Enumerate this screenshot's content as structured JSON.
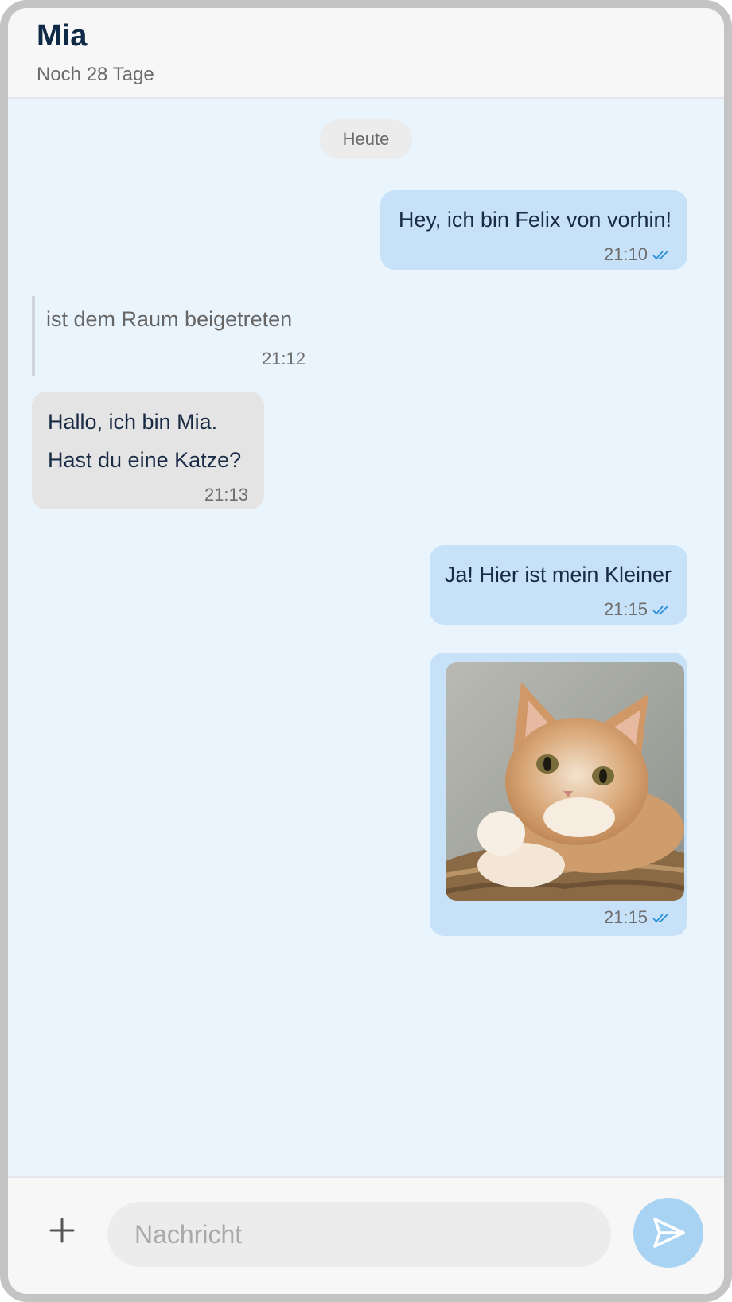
{
  "header": {
    "title": "Mia",
    "subtitle": "Noch 28 Tage"
  },
  "day_separator": "Heute",
  "messages": [
    {
      "type": "outgoing",
      "text": "Hey, ich bin Felix von vorhin!",
      "time": "21:10",
      "status": "read"
    },
    {
      "type": "system",
      "text": "ist dem Raum beigetreten",
      "time": "21:12"
    },
    {
      "type": "incoming",
      "lines": [
        "Hallo, ich bin Mia.",
        "Hast du eine Katze?"
      ],
      "time": "21:13"
    },
    {
      "type": "outgoing",
      "text": "Ja! Hier ist mein Kleiner",
      "time": "21:15",
      "status": "read"
    },
    {
      "type": "outgoing-image",
      "image": "orange-white-cat-on-wicker-basket",
      "time": "21:15",
      "status": "read"
    }
  ],
  "composer": {
    "placeholder": "Nachricht",
    "add_icon": "plus-icon",
    "send_icon": "send-icon"
  },
  "colors": {
    "background": "#eaf4fd",
    "outgoing_bubble": "#c7e2f8",
    "incoming_bubble": "#e4e4e4",
    "send_button": "#a8d3f3",
    "read_check": "#2d8fd6"
  }
}
